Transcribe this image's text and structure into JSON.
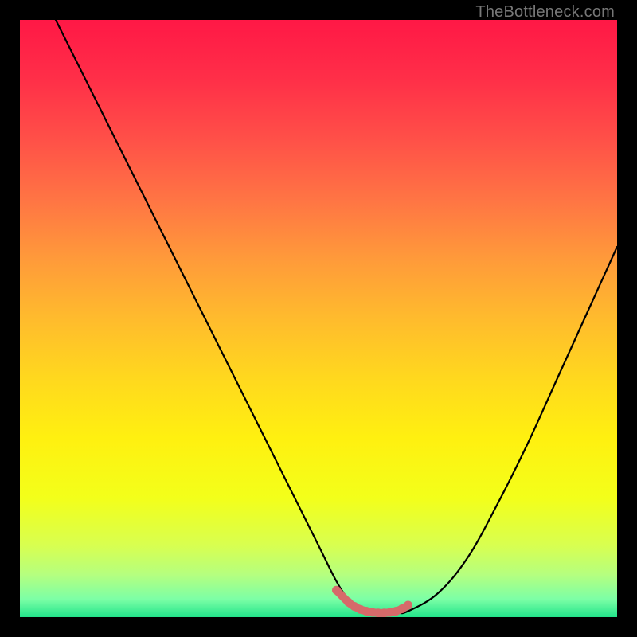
{
  "watermark": "TheBottleneck.com",
  "gradient": {
    "stops": [
      {
        "offset": 0.0,
        "color": "#ff1846"
      },
      {
        "offset": 0.1,
        "color": "#ff2f48"
      },
      {
        "offset": 0.2,
        "color": "#ff5048"
      },
      {
        "offset": 0.3,
        "color": "#ff7444"
      },
      {
        "offset": 0.4,
        "color": "#ff9a3a"
      },
      {
        "offset": 0.5,
        "color": "#ffbb2d"
      },
      {
        "offset": 0.6,
        "color": "#ffd81e"
      },
      {
        "offset": 0.7,
        "color": "#fff010"
      },
      {
        "offset": 0.8,
        "color": "#f3ff1a"
      },
      {
        "offset": 0.88,
        "color": "#d8ff50"
      },
      {
        "offset": 0.93,
        "color": "#b4ff80"
      },
      {
        "offset": 0.97,
        "color": "#7cffa6"
      },
      {
        "offset": 1.0,
        "color": "#22e48a"
      }
    ]
  },
  "chart_data": {
    "type": "line",
    "title": "",
    "xlabel": "",
    "ylabel": "",
    "xlim": [
      0,
      100
    ],
    "ylim": [
      0,
      100
    ],
    "series": [
      {
        "name": "curve",
        "x": [
          6,
          10,
          15,
          20,
          25,
          30,
          35,
          40,
          45,
          50,
          53,
          55,
          57,
          60,
          63,
          65,
          70,
          75,
          80,
          85,
          90,
          95,
          100
        ],
        "y": [
          100,
          92,
          82,
          72,
          62,
          52,
          42,
          32,
          22,
          12,
          6,
          3,
          1,
          0.7,
          0.7,
          1,
          4,
          10,
          19,
          29,
          40,
          51,
          62
        ]
      }
    ],
    "highlight": {
      "color": "#d66a6a",
      "x": [
        53,
        55,
        56,
        57,
        58,
        59,
        60,
        61,
        62,
        63,
        64,
        65
      ],
      "y": [
        4.5,
        2.5,
        1.8,
        1.3,
        1.0,
        0.8,
        0.7,
        0.7,
        0.8,
        1.0,
        1.4,
        2.0
      ]
    }
  }
}
